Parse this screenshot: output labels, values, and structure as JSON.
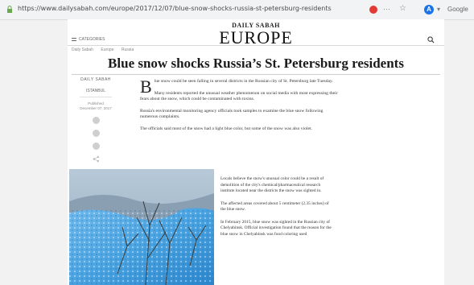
{
  "browser": {
    "url": "https://www.dailysabah.com/europe/2017/12/07/blue-snow-shocks-russia-st-petersburg-residents",
    "profile_initial": "A",
    "search_engine_label": "Google"
  },
  "site": {
    "brand": "DAILY SABAH",
    "section": "EUROPE",
    "categories_label": "CATEGORIES",
    "breadcrumbs": [
      "Daily Sabah",
      "Europe",
      "Russia"
    ]
  },
  "article": {
    "headline": "Blue snow shocks Russia’s St. Petersburg residents",
    "author": "DAILY SABAH",
    "city": "ISTANBUL",
    "published_label": "Published",
    "published_date": "December 07, 2017",
    "dropcap": "B",
    "lead": "lue snow could be seen falling in several districts in the Russian city of St. Petersburg late Tuesday.",
    "paragraphs": [
      "Many residents reported the unusual weather phenomenon on social media with most expressing their fears about the snow, which could be contaminated with toxins.",
      "Russia's environmental monitoring agency officials took samples to examine the blue snow following numerous complaints.",
      "The officials said most of the snow had a light blue color, but some of the snow was also violet."
    ],
    "column2": [
      "Locals believe the snow's unusual color could be a result of demolition of the city's chemical/pharmaceutical research institute located near the districts the snow was sighted in.",
      "The affected areas covered about 5 centimeter (2.35 inches) of the blue snow.",
      "In February 2015, blue snow was sighted in the Russian city of Chelyabinsk. Official investigation found that the reason for the blue snow in Chelyabinsk was food coloring used"
    ]
  },
  "icons": {
    "lock": "lock-icon",
    "search": "search-icon",
    "share": [
      "facebook-icon",
      "twitter-icon",
      "comment-icon",
      "share-icon",
      "print-icon"
    ]
  },
  "colors": {
    "ext_red": "#e53935",
    "profile_blue": "#1a73e8",
    "snow_blue": "#4aa3e0"
  }
}
